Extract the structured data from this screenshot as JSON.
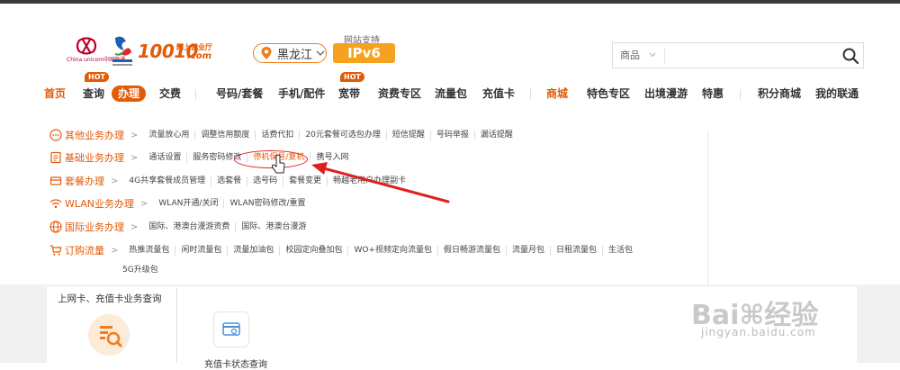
{
  "brand": {
    "name": "10010",
    "subtitle": "网上营业厅",
    "domain": ".com",
    "partner_text": "China unicom中国联通"
  },
  "location": {
    "province": "黑龙江"
  },
  "ipv6": {
    "label": "网站支持",
    "badge": "IPv6"
  },
  "search": {
    "category": "商品",
    "placeholder": ""
  },
  "nav": {
    "items": [
      {
        "label": "首页",
        "hot": ""
      },
      {
        "label": "查询",
        "hot": "HOT"
      },
      {
        "label": "办理",
        "hot": ""
      },
      {
        "label": "交费",
        "hot": ""
      },
      {
        "label": "号码/套餐",
        "hot": ""
      },
      {
        "label": "手机/配件",
        "hot": ""
      },
      {
        "label": "宽带",
        "hot": "HOT"
      },
      {
        "label": "资费专区",
        "hot": ""
      },
      {
        "label": "流量包",
        "hot": ""
      },
      {
        "label": "充值卡",
        "hot": ""
      },
      {
        "label": "商城",
        "hot": ""
      },
      {
        "label": "特色专区",
        "hot": ""
      },
      {
        "label": "出境漫游",
        "hot": ""
      },
      {
        "label": "特惠",
        "hot": ""
      },
      {
        "label": "积分商城",
        "hot": ""
      },
      {
        "label": "我的联通",
        "hot": ""
      }
    ]
  },
  "dropdown": {
    "rows": [
      {
        "category": "其他业务办理",
        "links": [
          "流量放心用",
          "调整信用额度",
          "话费代扣",
          "20元套餐可选包办理",
          "短信提醒",
          "号码举报",
          "漏话提醒"
        ]
      },
      {
        "category": "基础业务办理",
        "links": [
          "通话设置",
          "服务密码修改",
          "停机保号/复机",
          "携号入网"
        ]
      },
      {
        "category": "套餐办理",
        "links": [
          "4G共享套餐成员管理",
          "选套餐",
          "选号码",
          "套餐变更",
          "畅越老用户办理副卡"
        ]
      },
      {
        "category": "WLAN业务办理",
        "links": [
          "WLAN开通/关闭",
          "WLAN密码修改/重置"
        ]
      },
      {
        "category": "国际业务办理",
        "links": [
          "国际、港澳台漫游资费",
          "国际、港澳台漫游"
        ]
      },
      {
        "category": "订购流量",
        "links": [
          "热推流量包",
          "闲时流量包",
          "流量加油包",
          "校园定向叠加包",
          "WO+视频定向流量包",
          "假日畅游流量包",
          "流量月包",
          "日租流量包",
          "生活包"
        ],
        "links_wrap": "5G升级包"
      }
    ]
  },
  "lower": {
    "card_title": "上网卡、充值卡业务查询",
    "item_label": "充值卡状态查询"
  },
  "watermark": {
    "main": "Bai",
    "main2": "经验",
    "sub": "jingyan.baidu.com"
  },
  "colors": {
    "accent": "#e35a07",
    "annotation": "#e02020",
    "ipv6": "#f6a21e"
  }
}
